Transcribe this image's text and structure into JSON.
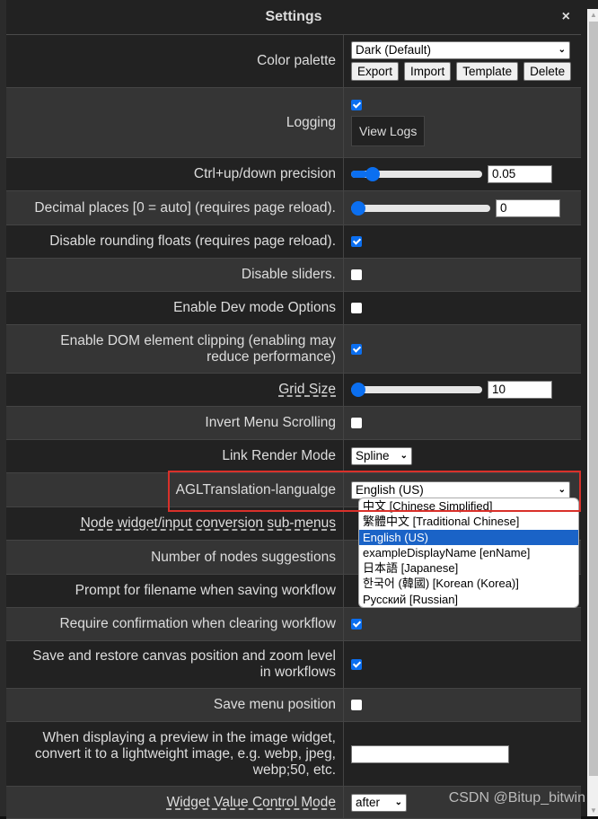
{
  "dialog": {
    "title": "Settings",
    "close_label": "×"
  },
  "settings": {
    "color_palette": {
      "label": "Color palette",
      "selected": "Dark (Default)",
      "buttons": [
        "Export",
        "Import",
        "Template",
        "Delete"
      ]
    },
    "logging": {
      "label": "Logging",
      "checked": true,
      "button": "View Logs"
    },
    "ctrl_precision": {
      "label": "Ctrl+up/down precision",
      "value": "0.05",
      "slider_fraction": 0.12
    },
    "decimal_places": {
      "label": "Decimal places [0 = auto] (requires page reload).",
      "value": "0",
      "slider_fraction": 0.0
    },
    "disable_rounding": {
      "label": "Disable rounding floats (requires page reload).",
      "checked": true
    },
    "disable_sliders": {
      "label": "Disable sliders.",
      "checked": false
    },
    "dev_mode": {
      "label": "Enable Dev mode Options",
      "checked": false
    },
    "dom_clipping": {
      "label": "Enable DOM element clipping (enabling may reduce performance)",
      "checked": true
    },
    "grid_size": {
      "label": "Grid Size",
      "value": "10",
      "slider_fraction": 0.0
    },
    "invert_menu": {
      "label": "Invert Menu Scrolling",
      "checked": false
    },
    "link_render": {
      "label": "Link Render Mode",
      "selected": "Spline"
    },
    "agl_language": {
      "label": "AGLTranslation-langualge",
      "selected": "English (US)",
      "options": [
        "中文 [Chinese Simplified]",
        "繁體中文 [Traditional Chinese]",
        "English (US)",
        "exampleDisplayName [enName]",
        "日本語 [Japanese]",
        "한국어 (韓國) [Korean (Korea)]",
        "Русский [Russian]"
      ],
      "highlighted_index": 2
    },
    "node_widget_submenus": {
      "label": "Node widget/input conversion sub-menus"
    },
    "node_suggestions": {
      "label": "Number of nodes suggestions"
    },
    "prompt_filename": {
      "label": "Prompt for filename when saving workflow"
    },
    "confirm_clear": {
      "label": "Require confirmation when clearing workflow",
      "checked": true
    },
    "save_canvas": {
      "label": "Save and restore canvas position and zoom level in workflows",
      "checked": true
    },
    "save_menu_pos": {
      "label": "Save menu position",
      "checked": false
    },
    "preview_format": {
      "label": "When displaying a preview in the image widget, convert it to a lightweight image, e.g. webp, jpeg, webp;50, etc.",
      "value": ""
    },
    "widget_control_mode": {
      "label": "Widget Value Control Mode",
      "selected": "after"
    }
  },
  "watermark": "CSDN @Bitup_bitwin",
  "colors": {
    "accent": "#0b6ff0",
    "highlight_border": "#d9302a",
    "row_dark": "#222222",
    "row_light": "#353535"
  }
}
